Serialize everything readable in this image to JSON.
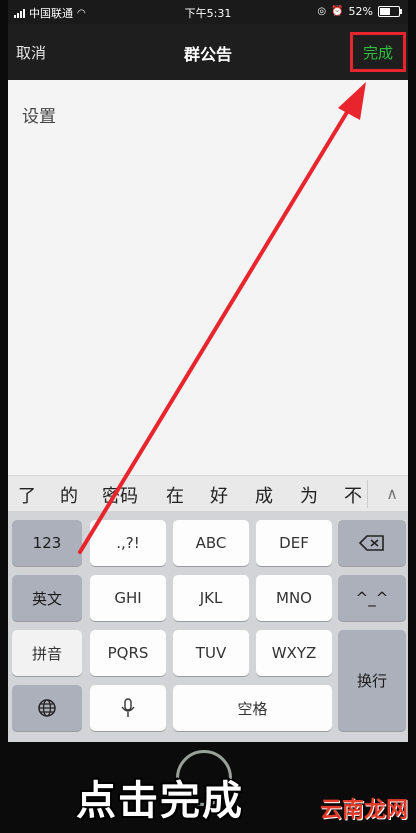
{
  "status": {
    "carrier": "中国联通",
    "time": "下午5:31",
    "battery": "52%"
  },
  "nav": {
    "cancel": "取消",
    "title": "群公告",
    "done": "完成"
  },
  "content": {
    "text": "设置"
  },
  "candidates": [
    "了",
    "的",
    "密码",
    "在",
    "好",
    "成",
    "为",
    "不"
  ],
  "keyboard": {
    "k123": "123",
    "punct": ".,?!",
    "abc": "ABC",
    "def": "DEF",
    "english": "英文",
    "ghi": "GHI",
    "jkl": "JKL",
    "mno": "MNO",
    "emoji": "^_^",
    "pinyin": "拼音",
    "pqrs": "PQRS",
    "tuv": "TUV",
    "wxyz": "WXYZ",
    "newline": "换行",
    "space": "空格"
  },
  "caption": {
    "text": "点击完成",
    "watermark": "云南龙网"
  },
  "colors": {
    "highlight_box": "#e8242c",
    "done_green": "#2fbf3f",
    "arrow": "#e8242c"
  }
}
